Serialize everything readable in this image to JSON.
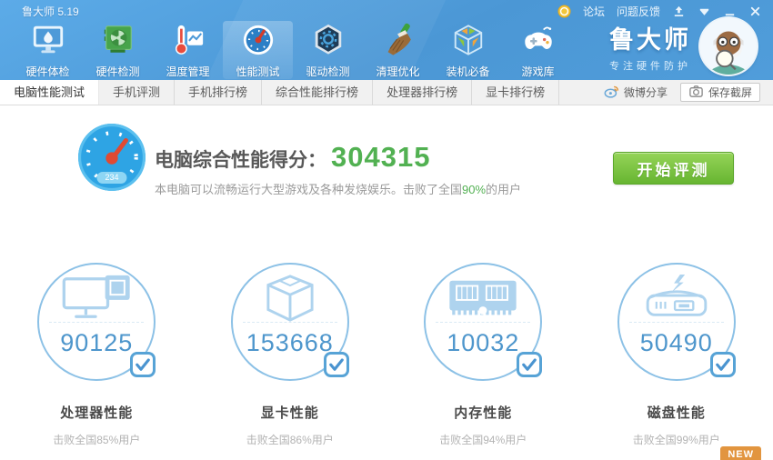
{
  "window": {
    "title": "鲁大师 5.19"
  },
  "titlebar": {
    "forum": "论坛",
    "feedback": "问题反馈"
  },
  "toolbar": {
    "items": [
      "硬件体检",
      "硬件检测",
      "温度管理",
      "性能测试",
      "驱动检测",
      "清理优化",
      "装机必备",
      "游戏库"
    ]
  },
  "brand": {
    "name": "鲁大师",
    "slogan": "专注硬件防护"
  },
  "tabs": [
    "电脑性能测试",
    "手机评测",
    "手机排行榜",
    "综合性能排行榜",
    "处理器排行榜",
    "显卡排行榜"
  ],
  "tab_actions": {
    "weibo_share": "微博分享",
    "save_screenshot": "保存截屏"
  },
  "score": {
    "label": "电脑综合性能得分：",
    "value": "304315",
    "desc_prefix": "本电脑可以流畅运行大型游戏及各种发烧娱乐。击败了全国",
    "desc_percent": "90%",
    "desc_suffix": "的用户",
    "start_button": "开始评测",
    "gauge_badge": "234"
  },
  "gauges": [
    {
      "score": "90125",
      "label": "处理器性能",
      "beat": "击败全国85%用户"
    },
    {
      "score": "153668",
      "label": "显卡性能",
      "beat": "击败全国86%用户"
    },
    {
      "score": "10032",
      "label": "内存性能",
      "beat": "击败全国94%用户"
    },
    {
      "score": "50490",
      "label": "磁盘性能",
      "beat": "击败全国99%用户"
    }
  ],
  "badge_new": "NEW",
  "colors": {
    "header_blue": "#4f9bd8",
    "accent_green": "#52b152",
    "gauge_blue": "#4e96cc",
    "circle_border": "#8cc1e6",
    "badge_orange": "#e2953f"
  }
}
